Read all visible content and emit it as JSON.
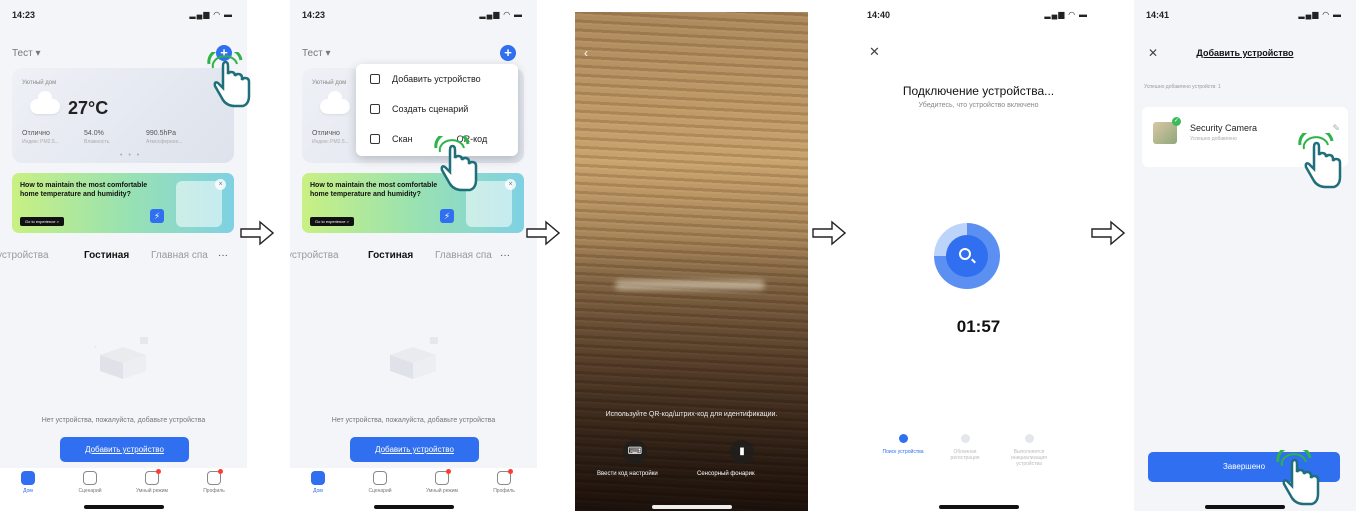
{
  "screen1": {
    "time": "14:23",
    "home_name": "Тест ▾",
    "weather": {
      "location": "Уютный дом",
      "temp": "27°C",
      "metrics": [
        {
          "value": "Отлично",
          "label": "Индекс PM2.5..."
        },
        {
          "value": "54.0%",
          "label": "Влажность"
        },
        {
          "value": "990.5hPa",
          "label": "Атмосферное..."
        }
      ]
    },
    "banner": {
      "title": "How to maintain the most comfortable home temperature and humidity?",
      "button": "Go to experience >"
    },
    "tabs": [
      "устройства",
      "Гостиная",
      "Главная спа",
      "···"
    ],
    "empty_text": "Нет устройства, пожалуйста, добавьте устройства",
    "add_button": "Добавить устройство",
    "tabbar": [
      "Дом",
      "Сценарий",
      "Умный режим",
      "Профиль"
    ]
  },
  "screen2": {
    "time": "14:23",
    "home_name": "Тест ▾",
    "menu": [
      "Добавить устройство",
      "Создать сценарий",
      "Сканировать QR-код"
    ],
    "menu_visible_scan": [
      "Скан",
      "QR-код"
    ]
  },
  "screen3": {
    "hint": "Используйте QR-код/штрих-код для идентификации.",
    "left_button": "Ввести код настройки",
    "right_button": "Сенсорный фонарик"
  },
  "screen4": {
    "time": "14:40",
    "title": "Подключение устройства...",
    "subtitle": "Убедитесь, что устройство включено",
    "timer": "01:57",
    "steps": [
      "Поиск устройства",
      "Облачная регистрация",
      "Выполняется инициализация устройства"
    ]
  },
  "screen5": {
    "time": "14:41",
    "title": "Добавить устройство",
    "count_text": "Успешно добавлено устройств: 1",
    "device_name": "Security Camera",
    "device_status": "Успешно добавлено",
    "done_button": "Завершено"
  },
  "colors": {
    "accent": "#2f6ff0",
    "success": "#3dbb5c",
    "hand": "#1f6f7a",
    "pulse": "#2db34a"
  }
}
